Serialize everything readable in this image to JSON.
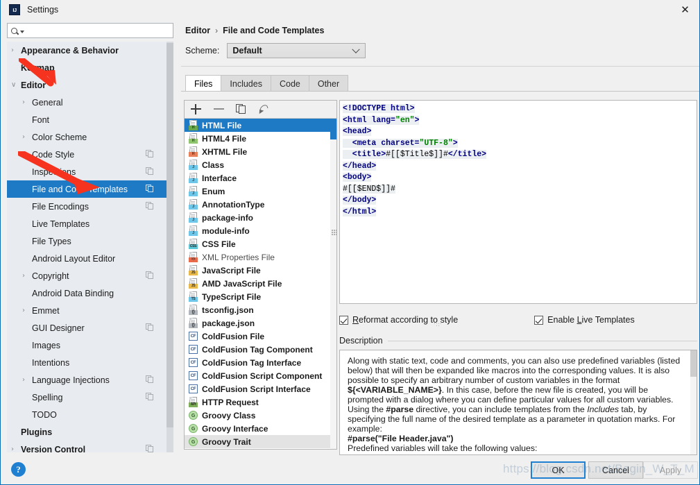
{
  "window": {
    "title": "Settings",
    "logo_text": "IJ",
    "close_icon": "close-icon"
  },
  "search": {
    "value": "",
    "placeholder": ""
  },
  "sidebar": {
    "items": [
      {
        "label": "Appearance & Behavior",
        "depth": 0,
        "arrow": "›",
        "bold": true,
        "copy": false,
        "selected": false
      },
      {
        "label": "Keymap",
        "depth": 0,
        "arrow": "",
        "bold": true,
        "copy": false,
        "selected": false
      },
      {
        "label": "Editor",
        "depth": 0,
        "arrow": "∨",
        "bold": true,
        "copy": false,
        "selected": false
      },
      {
        "label": "General",
        "depth": 1,
        "arrow": "›",
        "bold": false,
        "copy": false,
        "selected": false
      },
      {
        "label": "Font",
        "depth": 1,
        "arrow": "",
        "bold": false,
        "copy": false,
        "selected": false
      },
      {
        "label": "Color Scheme",
        "depth": 1,
        "arrow": "›",
        "bold": false,
        "copy": false,
        "selected": false
      },
      {
        "label": "Code Style",
        "depth": 1,
        "arrow": "›",
        "bold": false,
        "copy": true,
        "selected": false
      },
      {
        "label": "Inspections",
        "depth": 1,
        "arrow": "",
        "bold": false,
        "copy": true,
        "selected": false
      },
      {
        "label": "File and Code Templates",
        "depth": 1,
        "arrow": "",
        "bold": false,
        "copy": true,
        "selected": true
      },
      {
        "label": "File Encodings",
        "depth": 1,
        "arrow": "",
        "bold": false,
        "copy": true,
        "selected": false
      },
      {
        "label": "Live Templates",
        "depth": 1,
        "arrow": "",
        "bold": false,
        "copy": false,
        "selected": false
      },
      {
        "label": "File Types",
        "depth": 1,
        "arrow": "",
        "bold": false,
        "copy": false,
        "selected": false
      },
      {
        "label": "Android Layout Editor",
        "depth": 1,
        "arrow": "",
        "bold": false,
        "copy": false,
        "selected": false
      },
      {
        "label": "Copyright",
        "depth": 1,
        "arrow": "›",
        "bold": false,
        "copy": true,
        "selected": false
      },
      {
        "label": "Android Data Binding",
        "depth": 1,
        "arrow": "",
        "bold": false,
        "copy": false,
        "selected": false
      },
      {
        "label": "Emmet",
        "depth": 1,
        "arrow": "›",
        "bold": false,
        "copy": false,
        "selected": false
      },
      {
        "label": "GUI Designer",
        "depth": 1,
        "arrow": "",
        "bold": false,
        "copy": true,
        "selected": false
      },
      {
        "label": "Images",
        "depth": 1,
        "arrow": "",
        "bold": false,
        "copy": false,
        "selected": false
      },
      {
        "label": "Intentions",
        "depth": 1,
        "arrow": "",
        "bold": false,
        "copy": false,
        "selected": false
      },
      {
        "label": "Language Injections",
        "depth": 1,
        "arrow": "›",
        "bold": false,
        "copy": true,
        "selected": false
      },
      {
        "label": "Spelling",
        "depth": 1,
        "arrow": "",
        "bold": false,
        "copy": true,
        "selected": false
      },
      {
        "label": "TODO",
        "depth": 1,
        "arrow": "",
        "bold": false,
        "copy": false,
        "selected": false
      },
      {
        "label": "Plugins",
        "depth": 0,
        "arrow": "",
        "bold": true,
        "copy": false,
        "selected": false
      },
      {
        "label": "Version Control",
        "depth": 0,
        "arrow": "›",
        "bold": true,
        "copy": true,
        "selected": false
      }
    ]
  },
  "breadcrumb": {
    "parent": "Editor",
    "separator": "›",
    "current": "File and Code Templates"
  },
  "scheme": {
    "label": "Scheme:",
    "value": "Default"
  },
  "tabs": [
    {
      "label": "Files",
      "active": true
    },
    {
      "label": "Includes",
      "active": false
    },
    {
      "label": "Code",
      "active": false
    },
    {
      "label": "Other",
      "active": false
    }
  ],
  "list_toolbar": [
    {
      "name": "add-template-button",
      "icon": "plus-icon"
    },
    {
      "name": "remove-template-button",
      "icon": "minus-icon"
    },
    {
      "name": "copy-template-button",
      "icon": "copy-icon"
    },
    {
      "name": "reset-template-button",
      "icon": "undo-icon"
    }
  ],
  "templates": [
    {
      "label": "HTML File",
      "icon": "html-file-icon",
      "tag": "H",
      "style": "page",
      "color": "#6aa84f",
      "selected": true,
      "hover": false,
      "dim": false
    },
    {
      "label": "HTML4 File",
      "icon": "html4-file-icon",
      "tag": "H",
      "style": "page",
      "color": "#8ec56e",
      "selected": false,
      "hover": false,
      "dim": false
    },
    {
      "label": "XHTML File",
      "icon": "xhtml-file-icon",
      "tag": "H",
      "style": "page",
      "color": "#e8815a",
      "selected": false,
      "hover": false,
      "dim": false
    },
    {
      "label": "Class",
      "icon": "java-class-icon",
      "tag": "J",
      "style": "page",
      "color": "#6ec6e8",
      "selected": false,
      "hover": false,
      "dim": false
    },
    {
      "label": "Interface",
      "icon": "java-interface-icon",
      "tag": "J",
      "style": "page",
      "color": "#6ec6e8",
      "selected": false,
      "hover": false,
      "dim": false
    },
    {
      "label": "Enum",
      "icon": "java-enum-icon",
      "tag": "J",
      "style": "page",
      "color": "#6ec6e8",
      "selected": false,
      "hover": false,
      "dim": false
    },
    {
      "label": "AnnotationType",
      "icon": "java-annotation-icon",
      "tag": "J",
      "style": "page",
      "color": "#6ec6e8",
      "selected": false,
      "hover": false,
      "dim": false
    },
    {
      "label": "package-info",
      "icon": "java-package-info-icon",
      "tag": "J",
      "style": "page",
      "color": "#6ec6e8",
      "selected": false,
      "hover": false,
      "dim": false
    },
    {
      "label": "module-info",
      "icon": "java-module-info-icon",
      "tag": "J",
      "style": "page",
      "color": "#6ec6e8",
      "selected": false,
      "hover": false,
      "dim": false
    },
    {
      "label": "CSS File",
      "icon": "css-file-icon",
      "tag": "CSS",
      "style": "page",
      "color": "#5bc8d8",
      "selected": false,
      "hover": false,
      "dim": false
    },
    {
      "label": "XML Properties File",
      "icon": "xml-properties-icon",
      "tag": "<>",
      "style": "page",
      "color": "#e86a4a",
      "selected": false,
      "hover": false,
      "dim": true
    },
    {
      "label": "JavaScript File",
      "icon": "javascript-file-icon",
      "tag": "JS",
      "style": "page",
      "color": "#e8b84a",
      "selected": false,
      "hover": false,
      "dim": false
    },
    {
      "label": "AMD JavaScript File",
      "icon": "amd-javascript-file-icon",
      "tag": "JS",
      "style": "page",
      "color": "#e8b84a",
      "selected": false,
      "hover": false,
      "dim": false
    },
    {
      "label": "TypeScript File",
      "icon": "typescript-file-icon",
      "tag": "TS",
      "style": "page",
      "color": "#6ec6e8",
      "selected": false,
      "hover": false,
      "dim": false
    },
    {
      "label": "tsconfig.json",
      "icon": "json-file-icon",
      "tag": "{}",
      "style": "json",
      "color": "#b0b6bb",
      "selected": false,
      "hover": false,
      "dim": false
    },
    {
      "label": "package.json",
      "icon": "json-file-icon",
      "tag": "{}",
      "style": "json",
      "color": "#b0b6bb",
      "selected": false,
      "hover": false,
      "dim": false
    },
    {
      "label": "ColdFusion File",
      "icon": "coldfusion-file-icon",
      "tag": "CF",
      "style": "square",
      "color": "#4a6fa5",
      "selected": false,
      "hover": false,
      "dim": false
    },
    {
      "label": "ColdFusion Tag Component",
      "icon": "coldfusion-tag-component-icon",
      "tag": "CF",
      "style": "square",
      "color": "#4a6fa5",
      "selected": false,
      "hover": false,
      "dim": false
    },
    {
      "label": "ColdFusion Tag Interface",
      "icon": "coldfusion-tag-interface-icon",
      "tag": "CF",
      "style": "square",
      "color": "#4a6fa5",
      "selected": false,
      "hover": false,
      "dim": false
    },
    {
      "label": "ColdFusion Script Component",
      "icon": "coldfusion-script-component-icon",
      "tag": "CF",
      "style": "square",
      "color": "#4a6fa5",
      "selected": false,
      "hover": false,
      "dim": false
    },
    {
      "label": "ColdFusion Script Interface",
      "icon": "coldfusion-script-interface-icon",
      "tag": "CF",
      "style": "square",
      "color": "#4a6fa5",
      "selected": false,
      "hover": false,
      "dim": false
    },
    {
      "label": "HTTP Request",
      "icon": "http-request-icon",
      "tag": "API",
      "style": "page",
      "color": "#7fae5a",
      "selected": false,
      "hover": false,
      "dim": false
    },
    {
      "label": "Groovy Class",
      "icon": "groovy-class-icon",
      "tag": "G",
      "style": "circle",
      "color": "#b8e0a8",
      "selected": false,
      "hover": false,
      "dim": false
    },
    {
      "label": "Groovy Interface",
      "icon": "groovy-interface-icon",
      "tag": "G",
      "style": "circle",
      "color": "#b8e0a8",
      "selected": false,
      "hover": false,
      "dim": false
    },
    {
      "label": "Groovy Trait",
      "icon": "groovy-trait-icon",
      "tag": "G",
      "style": "circle",
      "color": "#b8e0a8",
      "selected": false,
      "hover": true,
      "dim": false
    }
  ],
  "editor_code": [
    [
      {
        "t": "<!DOCTYPE ",
        "c": "tg"
      },
      {
        "t": "html",
        "c": "at"
      },
      {
        "t": ">",
        "c": "tg"
      }
    ],
    [
      {
        "t": "<html ",
        "c": "tg"
      },
      {
        "t": "lang=",
        "c": "at"
      },
      {
        "t": "\"en\"",
        "c": "st"
      },
      {
        "t": ">",
        "c": "tg"
      }
    ],
    [
      {
        "t": "<head>",
        "c": "tg"
      }
    ],
    [
      {
        "t": "  <meta ",
        "c": "tg"
      },
      {
        "t": "charset=",
        "c": "at"
      },
      {
        "t": "\"UTF-8\"",
        "c": "st"
      },
      {
        "t": ">",
        "c": "tg"
      }
    ],
    [
      {
        "t": "  <title>",
        "c": "tg"
      },
      {
        "t": "#[[$Title$]]#",
        "c": "pl"
      },
      {
        "t": "</title>",
        "c": "tg"
      }
    ],
    [
      {
        "t": "</head>",
        "c": "tg"
      }
    ],
    [
      {
        "t": "<body>",
        "c": "tg"
      }
    ],
    [
      {
        "t": "#[[$END$]]#",
        "c": "pl"
      }
    ],
    [
      {
        "t": "</body>",
        "c": "tg"
      }
    ],
    [
      {
        "t": "</html>",
        "c": "tg"
      }
    ]
  ],
  "checkboxes": [
    {
      "label_pre": "",
      "mnemonic": "R",
      "label_post": "eformat according to style",
      "checked": true,
      "name": "reformat-according-to-style-checkbox"
    },
    {
      "label_pre": "Enable ",
      "mnemonic": "L",
      "label_post": "ive Templates",
      "checked": true,
      "name": "enable-live-templates-checkbox"
    }
  ],
  "description": {
    "title": "Description",
    "paragraphs": [
      "Along with static text, code and comments, you can also use predefined variables (listed below) that will then be expanded like macros into the corresponding values. It is also possible to specify an arbitrary number of custom variables in the format ${<VARIABLE_NAME>}. In this case, before the new file is created, you will be prompted with a dialog where you can define particular values for all custom variables.",
      "Using the #parse directive, you can include templates from the Includes tab, by specifying the full name of the desired template as a parameter in quotation marks. For example:",
      "#parse(\"File Header.java\")",
      "Predefined variables will take the following values:"
    ]
  },
  "buttons": {
    "ok": "OK",
    "cancel": "Cancel",
    "apply": "Apply",
    "help": "?"
  },
  "watermark": "https://blog.csdn.net/Begin_W_T_M",
  "colors": {
    "selection_blue": "#1e7ac4",
    "annotation_red": "#f5331f",
    "accent_button_border": "#1f7fd0"
  }
}
